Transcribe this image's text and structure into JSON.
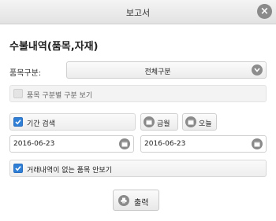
{
  "dialog": {
    "title": "보고서",
    "close_icon": "close-icon"
  },
  "section": {
    "title": "수불내역(품목,자재)"
  },
  "item_category": {
    "label": "품목구분:",
    "selected": "전체구분",
    "dropdown_icon": "chevron-down-icon"
  },
  "show_by_category": {
    "label": "품목 구분별 구분 보기",
    "checked": false,
    "disabled": true
  },
  "period_search": {
    "label": "기간 검색",
    "checked": true
  },
  "shortcuts": {
    "this_month": "금월",
    "today": "오늘"
  },
  "date_range": {
    "start": "2016-06-23",
    "end": "2016-06-23"
  },
  "hide_no_transactions": {
    "label": "거래내역이 없는 품목 안보기",
    "checked": true
  },
  "actions": {
    "print": "출력"
  },
  "colors": {
    "accent": "#2f7fd6",
    "icon_gray": "#8a8a8a"
  }
}
